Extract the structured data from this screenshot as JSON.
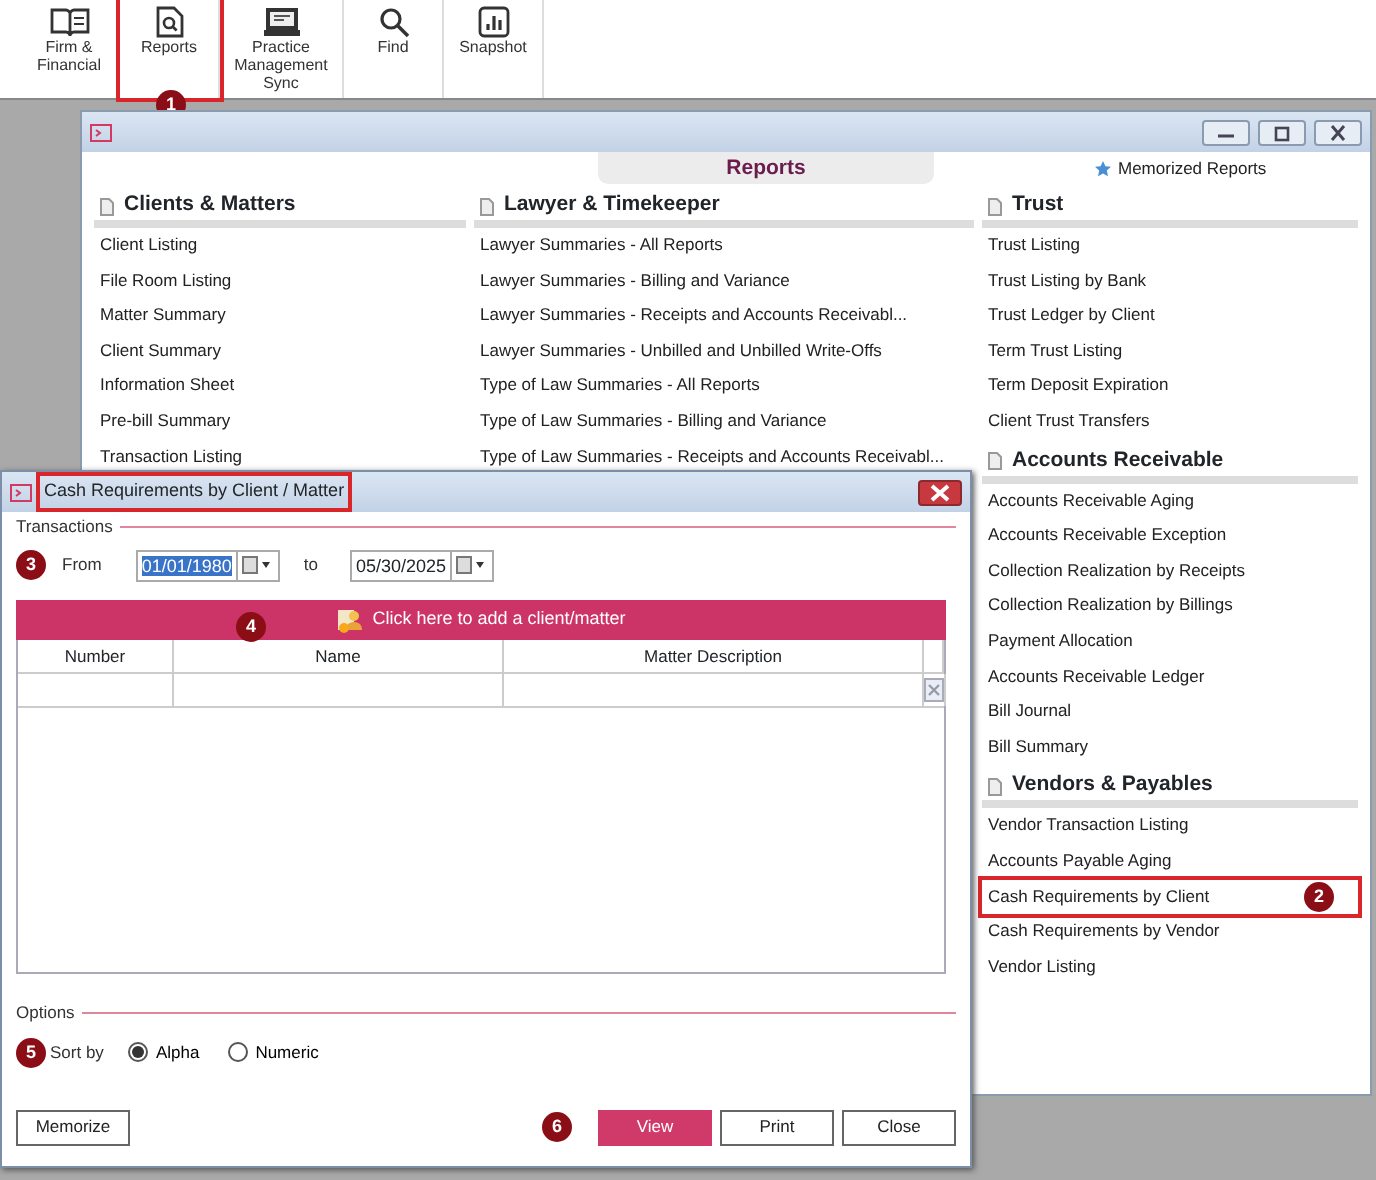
{
  "toolbar": [
    {
      "label": "Firm &\nFinancial",
      "kind": "book",
      "highlighted": false
    },
    {
      "label": "Reports",
      "kind": "report",
      "highlighted": true,
      "callout": "1"
    },
    {
      "label": "Practice\nManagement\nSync",
      "kind": "sync",
      "highlighted": false
    },
    {
      "label": "Find",
      "kind": "find",
      "highlighted": false
    },
    {
      "label": "Snapshot",
      "kind": "snapshot",
      "highlighted": false
    }
  ],
  "reports_window": {
    "tab": "Reports",
    "memorized": "Memorized Reports",
    "columns": [
      {
        "sections": [
          {
            "title": "Clients & Matters",
            "items": [
              {
                "label": "Client Listing",
                "highlighted": false
              },
              {
                "label": "File Room Listing",
                "highlighted": false
              },
              {
                "label": "Matter Summary",
                "highlighted": false
              },
              {
                "label": "Client Summary",
                "highlighted": false
              },
              {
                "label": "Information Sheet",
                "highlighted": false
              },
              {
                "label": "Pre-bill Summary",
                "highlighted": false
              },
              {
                "label": "Transaction Listing",
                "highlighted": false
              }
            ]
          }
        ]
      },
      {
        "sections": [
          {
            "title": "Lawyer & Timekeeper",
            "items": [
              {
                "label": "Lawyer Summaries - All Reports",
                "highlighted": false
              },
              {
                "label": "Lawyer Summaries - Billing and Variance",
                "highlighted": false
              },
              {
                "label": "Lawyer Summaries - Receipts and Accounts Receivabl...",
                "highlighted": false
              },
              {
                "label": "Lawyer Summaries - Unbilled and Unbilled Write-Offs",
                "highlighted": false
              },
              {
                "label": "Type of Law Summaries - All Reports",
                "highlighted": false
              },
              {
                "label": "Type of Law Summaries - Billing and Variance",
                "highlighted": false
              },
              {
                "label": "Type of Law Summaries - Receipts and Accounts Receivabl...",
                "highlighted": false
              }
            ]
          }
        ]
      },
      {
        "sections": [
          {
            "title": "Trust",
            "items": [
              {
                "label": "Trust Listing",
                "highlighted": false
              },
              {
                "label": "Trust Listing by Bank",
                "highlighted": false
              },
              {
                "label": "Trust Ledger by Client",
                "highlighted": false
              },
              {
                "label": "Term Trust Listing",
                "highlighted": false
              },
              {
                "label": "Term Deposit Expiration",
                "highlighted": false
              },
              {
                "label": "Client Trust Transfers",
                "highlighted": false
              }
            ]
          },
          {
            "title": "Accounts Receivable",
            "items": [
              {
                "label": "Accounts Receivable Aging",
                "highlighted": false
              },
              {
                "label": "Accounts Receivable Exception",
                "highlighted": false
              },
              {
                "label": "Collection Realization by Receipts",
                "highlighted": false
              },
              {
                "label": "Collection Realization by Billings",
                "highlighted": false
              },
              {
                "label": "Payment Allocation",
                "highlighted": false
              },
              {
                "label": "Accounts Receivable Ledger",
                "highlighted": false
              },
              {
                "label": "Bill Journal",
                "highlighted": false
              },
              {
                "label": "Bill Summary",
                "highlighted": false
              }
            ]
          },
          {
            "title": "Vendors & Payables",
            "items": [
              {
                "label": "Vendor Transaction Listing",
                "highlighted": false
              },
              {
                "label": "Accounts Payable Aging",
                "highlighted": false
              },
              {
                "label": "Cash Requirements by Client",
                "highlighted": true,
                "callout": "2"
              },
              {
                "label": "Cash Requirements by Vendor",
                "highlighted": false
              },
              {
                "label": "Vendor Listing",
                "highlighted": false
              }
            ]
          }
        ]
      }
    ]
  },
  "dialog": {
    "title": "Cash Requirements by Client / Matter",
    "title_highlighted": true,
    "transactions_label": "Transactions",
    "date_callout": "3",
    "from_label": "From",
    "from_date": "01/01/1980",
    "from_selected": true,
    "to_label": "to",
    "to_date": "05/30/2025",
    "to_selected": false,
    "add_label": "Click here to add a client/matter",
    "add_callout": "4",
    "table_columns": [
      "Number",
      "Name",
      "Matter Description"
    ],
    "options_label": "Options",
    "sort_callout": "5",
    "sort_label": "Sort by",
    "sort_options": [
      {
        "label": "Alpha",
        "selected": true
      },
      {
        "label": "Numeric",
        "selected": false
      }
    ],
    "buttons": [
      {
        "label": "Memorize",
        "kind": "default"
      },
      {
        "label": "View",
        "kind": "primary",
        "callout": "6"
      },
      {
        "label": "Print",
        "kind": "default"
      },
      {
        "label": "Close",
        "kind": "default"
      }
    ]
  }
}
